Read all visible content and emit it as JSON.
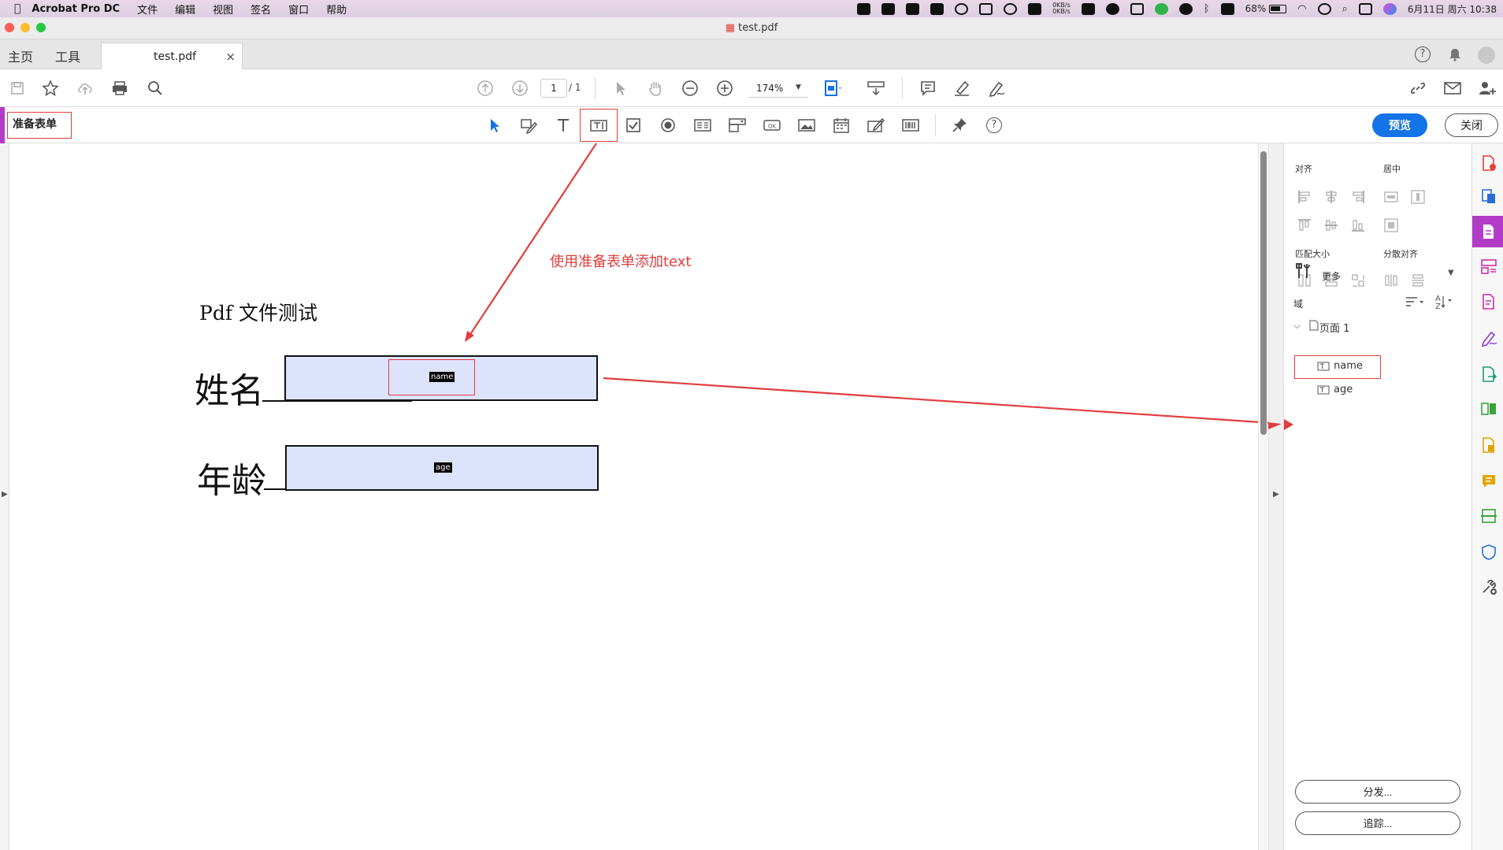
{
  "menubar": {
    "app_name": "Acrobat Pro DC",
    "items": [
      "文件",
      "编辑",
      "视图",
      "签名",
      "窗口",
      "帮助"
    ],
    "net_up": "0KB/s",
    "net_down": "0KB/s",
    "battery": "68%",
    "datetime": "6月11日 周六  10:38"
  },
  "window": {
    "title": "test.pdf"
  },
  "tabs": {
    "home": "主页",
    "tools": "工具",
    "document": "test.pdf",
    "close": "×"
  },
  "toolbar": {
    "page_current": "1",
    "page_total": "/ 1",
    "zoom": "174%"
  },
  "form_toolbar": {
    "title": "准备表单",
    "preview": "预览",
    "close": "关闭"
  },
  "document": {
    "title": "Pdf 文件测试",
    "field_name_label": "姓名",
    "field_name_tag": "name",
    "field_age_label": "年龄",
    "field_age_tag": "age",
    "annotation": "使用准备表单添加text"
  },
  "right_panel": {
    "align": "对齐",
    "center": "居中",
    "match_size": "匹配大小",
    "distribute": "分散对齐",
    "more": "更多",
    "fields": "域",
    "page": "页面 1",
    "field_items": [
      "name",
      "age"
    ],
    "distribute_btn": "分发...",
    "track_btn": "追踪..."
  },
  "colors": {
    "accent": "#b23cc7",
    "primary": "#1473e6",
    "highlight": "#e23d3d",
    "field_fill": "#dde3fb"
  }
}
